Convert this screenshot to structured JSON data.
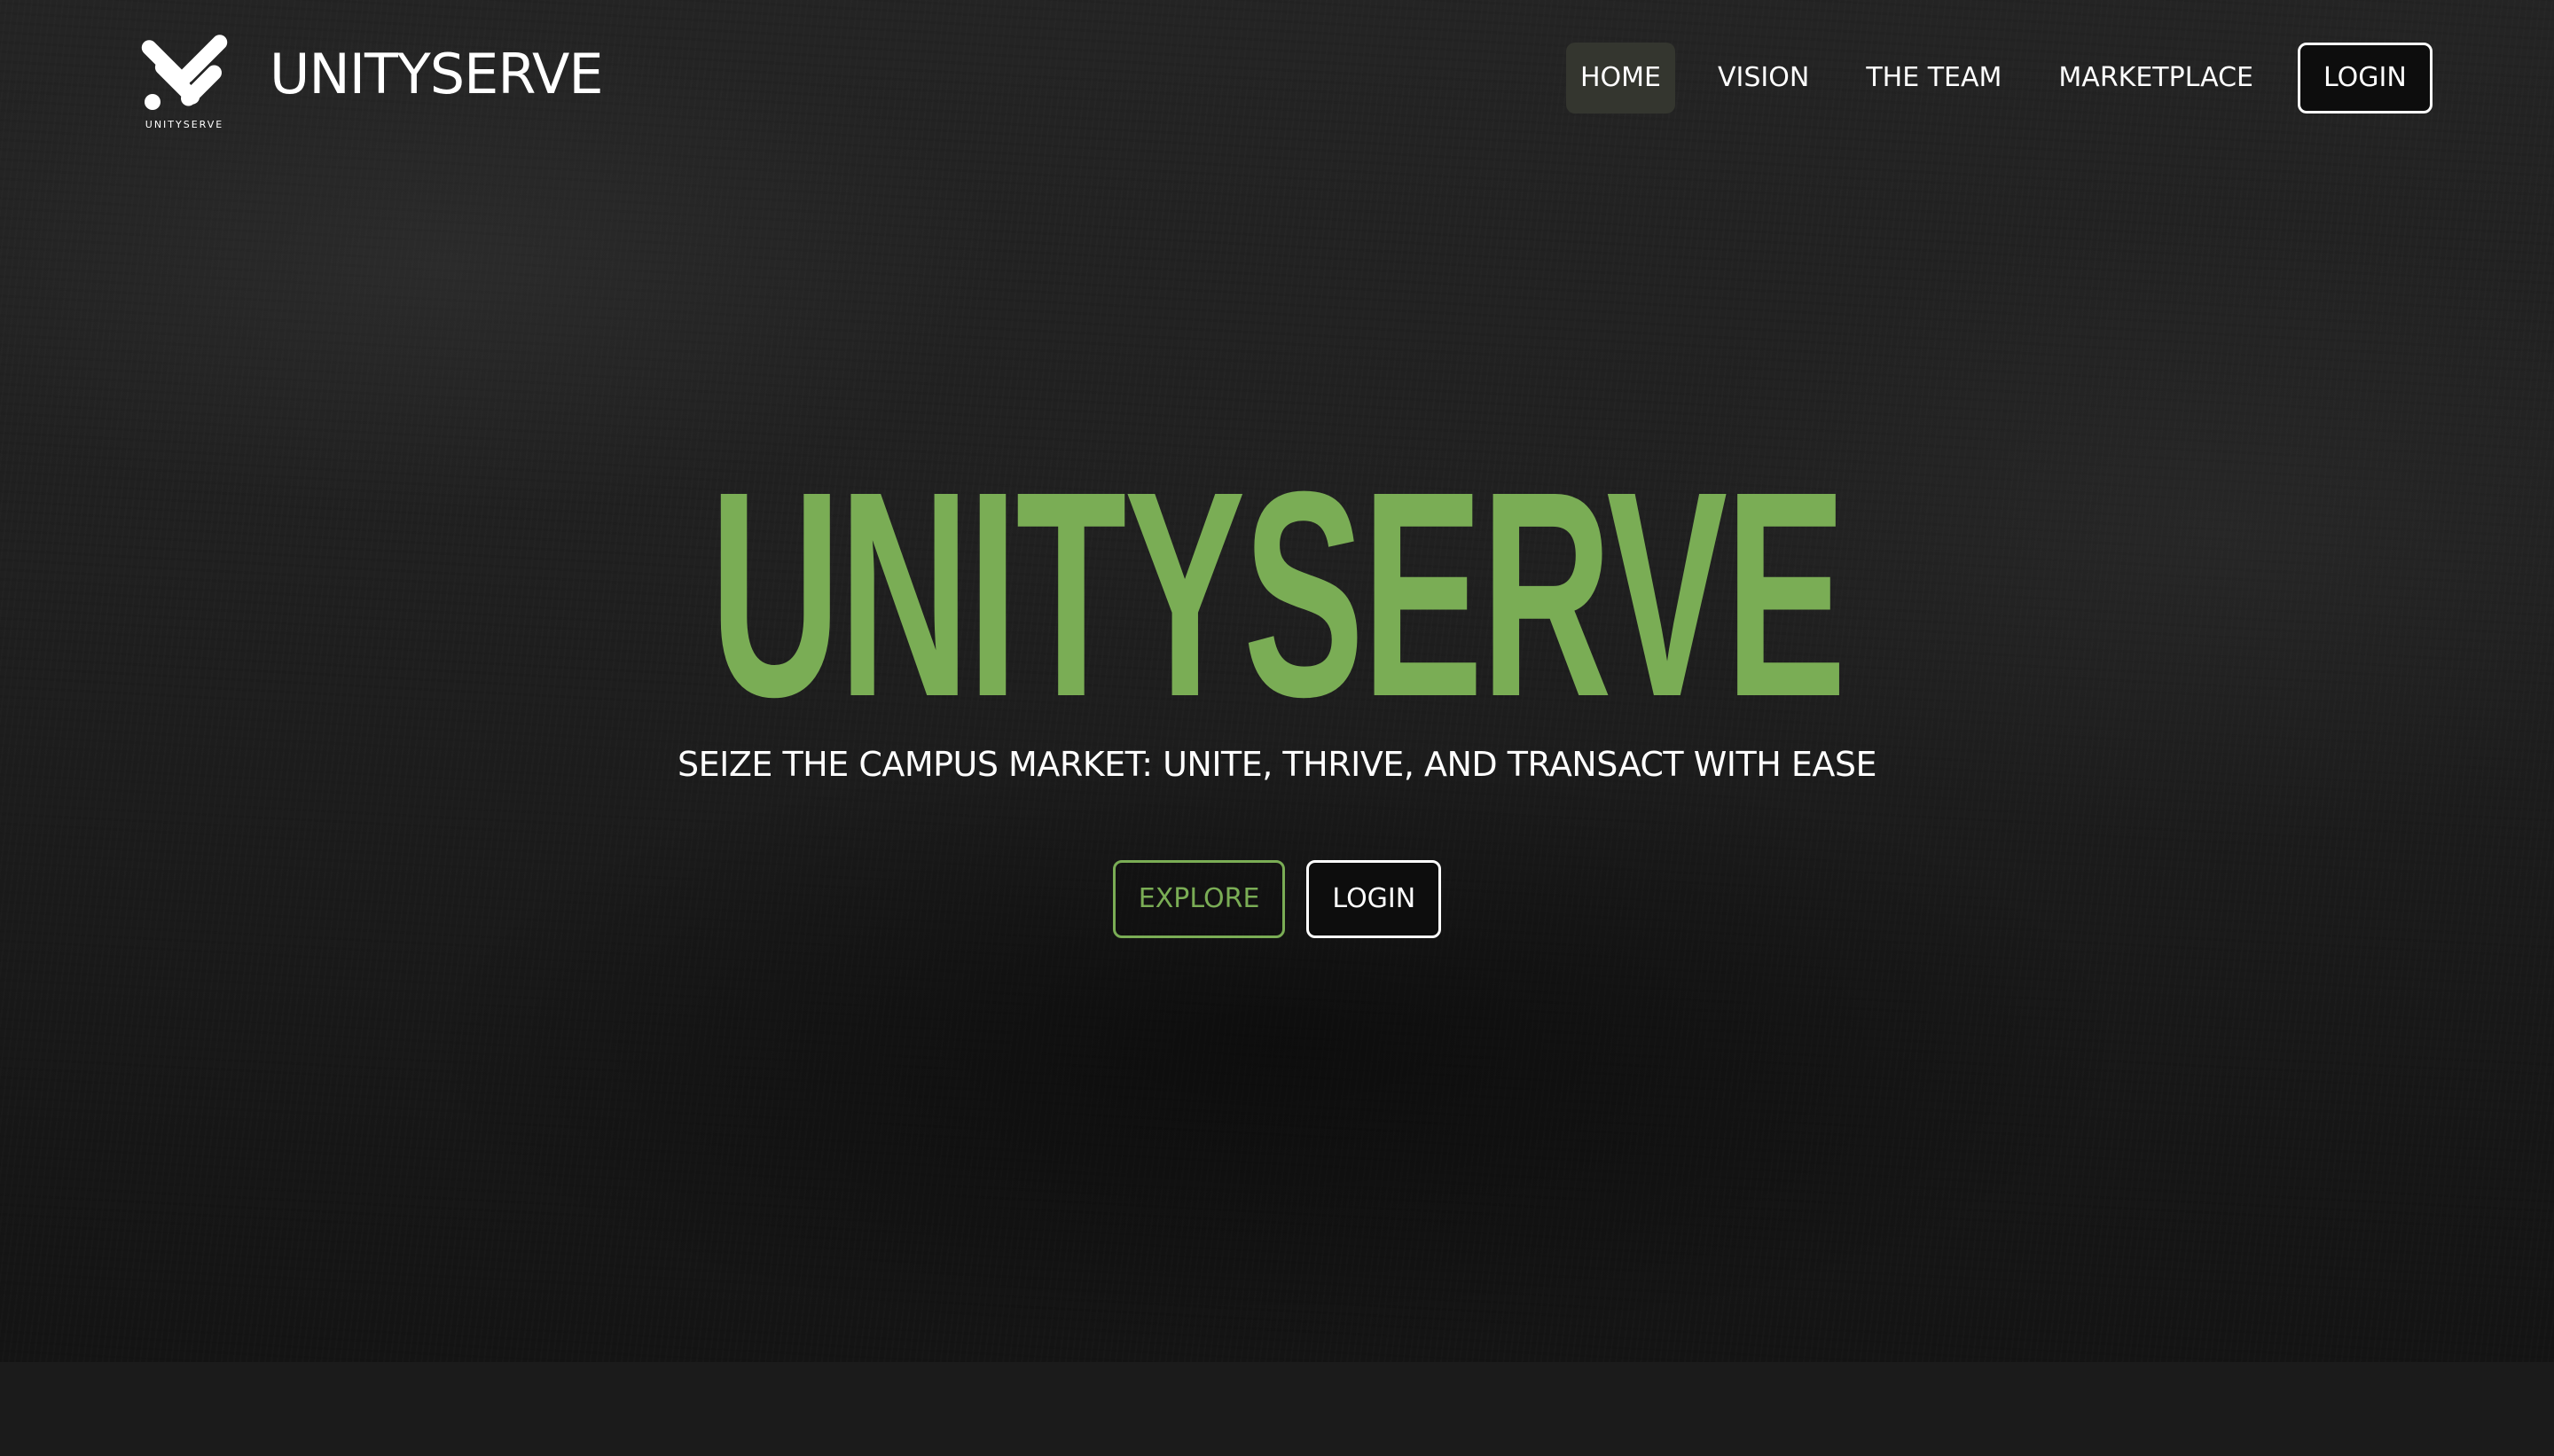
{
  "header": {
    "logo_icon": "unityserve-logo-icon",
    "logo_caption": "UNITYSERVE",
    "brand_name": "UNITYSERVE"
  },
  "nav": {
    "items": [
      {
        "label": "HOME",
        "active": true
      },
      {
        "label": "VISION",
        "active": false
      },
      {
        "label": "THE TEAM",
        "active": false
      },
      {
        "label": "MARKETPLACE",
        "active": false
      }
    ],
    "login_label": "LOGIN"
  },
  "hero": {
    "title": "UNITYSERVE",
    "subtitle": "SEIZE THE CAMPUS MARKET: UNITE, THRIVE, AND TRANSACT WITH EASE",
    "explore_label": "EXPLORE",
    "login_label": "LOGIN"
  },
  "colors": {
    "accent_green": "#7aad55",
    "background_dark": "#1b1b1b",
    "active_nav_bg": "#34362f",
    "text_white": "#ffffff"
  }
}
